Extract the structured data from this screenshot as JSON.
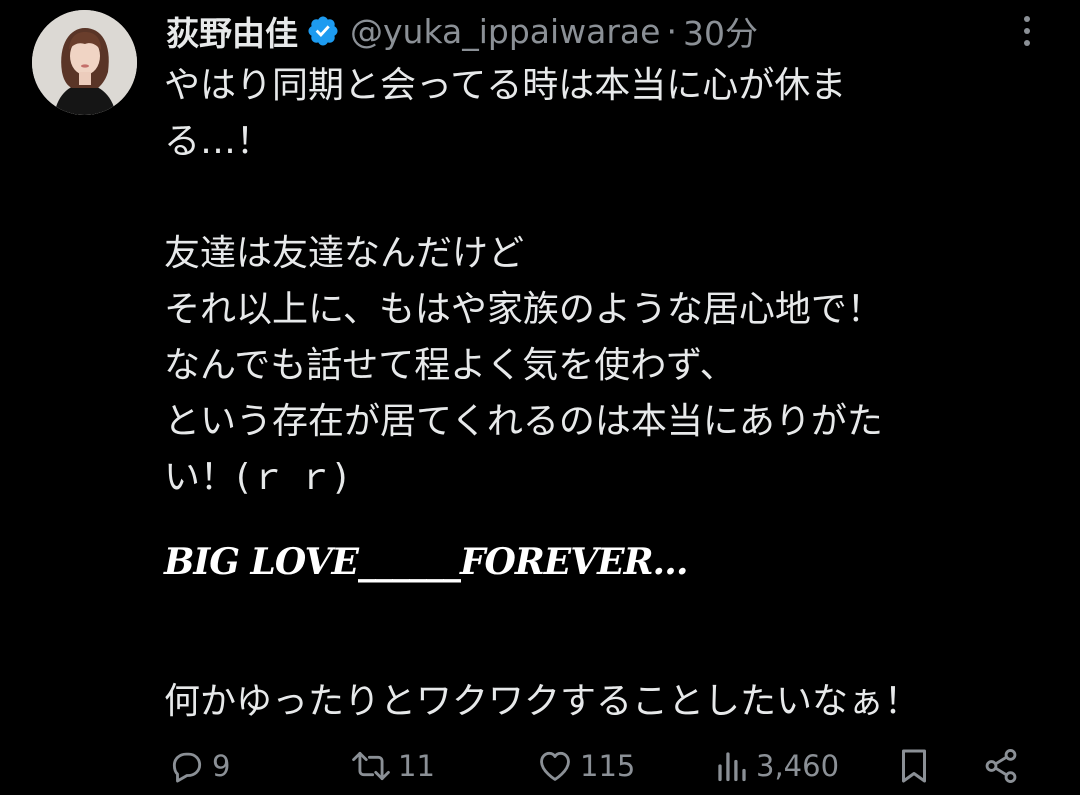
{
  "tweet": {
    "display_name": "荻野由佳",
    "handle": "@yuka_ippaiwarae",
    "separator": "·",
    "time": "30分",
    "verified": true,
    "lines": [
      "やはり同期と会ってる時は本当に心が休ま",
      "る…！",
      "",
      "友達は友達なんだけど",
      "それ以上に、もはや家族のような居心地で！",
      "なんでも話せて程よく気を使わず、",
      "という存在が居てくれるのは本当にありがた",
      "い！(ｒ ｒ)"
    ],
    "fancy_line": "BIG LOVE______FOREVER…",
    "last_line": "何かゆったりとワクワクすることしたいなぁ！"
  },
  "actions": {
    "replies": "9",
    "reposts": "11",
    "likes": "115",
    "views": "3,460"
  },
  "colors": {
    "background": "#000000",
    "text": "#e7e9ea",
    "muted": "#8b9096",
    "verified_badge": "#1d9bf0"
  },
  "icons": {
    "verified": "verified-badge-icon",
    "more": "more-vertical-icon",
    "reply": "reply-icon",
    "repost": "repost-icon",
    "like": "heart-icon",
    "views": "views-chart-icon",
    "bookmark": "bookmark-icon",
    "share": "share-icon"
  }
}
